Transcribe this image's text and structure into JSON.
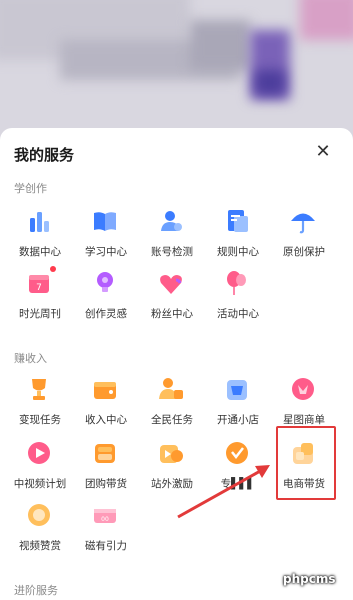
{
  "sheet": {
    "title": "我的服务",
    "close_icon": "close-icon"
  },
  "sections": [
    {
      "label": "学创作",
      "items": [
        {
          "label": "数据中心",
          "icon": "bar-chart-icon",
          "color": "#3b7cff"
        },
        {
          "label": "学习中心",
          "icon": "book-icon",
          "color": "#3b7cff"
        },
        {
          "label": "账号检测",
          "icon": "account-check-icon",
          "color": "#3b7cff"
        },
        {
          "label": "规则中心",
          "icon": "rules-doc-icon",
          "color": "#3b7cff"
        },
        {
          "label": "原创保护",
          "icon": "umbrella-icon",
          "color": "#3b7cff"
        },
        {
          "label": "时光周刊",
          "icon": "calendar-icon",
          "color": "#ff5c8a"
        },
        {
          "label": "创作灵感",
          "icon": "lightbulb-icon",
          "color": "#b45cff"
        },
        {
          "label": "粉丝中心",
          "icon": "heart-icon",
          "color": "#ff5c8a"
        },
        {
          "label": "活动中心",
          "icon": "balloon-icon",
          "color": "#ff5c8a"
        }
      ]
    },
    {
      "label": "赚收入",
      "items": [
        {
          "label": "变现任务",
          "icon": "trophy-icon",
          "color": "#ff9a2e"
        },
        {
          "label": "收入中心",
          "icon": "wallet-icon",
          "color": "#ff9a2e"
        },
        {
          "label": "全民任务",
          "icon": "people-task-icon",
          "color": "#ff9a2e"
        },
        {
          "label": "开通小店",
          "icon": "shop-icon",
          "color": "#3b7cff"
        },
        {
          "label": "星图商单",
          "icon": "star-map-icon",
          "color": "#ff5c8a"
        },
        {
          "label": "中视频计划",
          "icon": "play-icon",
          "color": "#ff5c8a"
        },
        {
          "label": "团购带货",
          "icon": "group-buy-icon",
          "color": "#ff9a2e"
        },
        {
          "label": "站外激励",
          "icon": "incentive-icon",
          "color": "#ff9a2e"
        },
        {
          "label": "专▌▌▌",
          "icon": "check-badge-icon",
          "color": "#ff9a2e"
        },
        {
          "label": "电商带货",
          "icon": "commerce-bag-icon",
          "color": "#ffbf5c"
        },
        {
          "label": "视频赞赏",
          "icon": "coin-icon",
          "color": "#ffbf5c"
        },
        {
          "label": "磁有引力",
          "icon": "magnet-ticket-icon",
          "color": "#ff9ab8"
        }
      ]
    },
    {
      "label": "进阶服务"
    }
  ],
  "watermark": "phpcms"
}
